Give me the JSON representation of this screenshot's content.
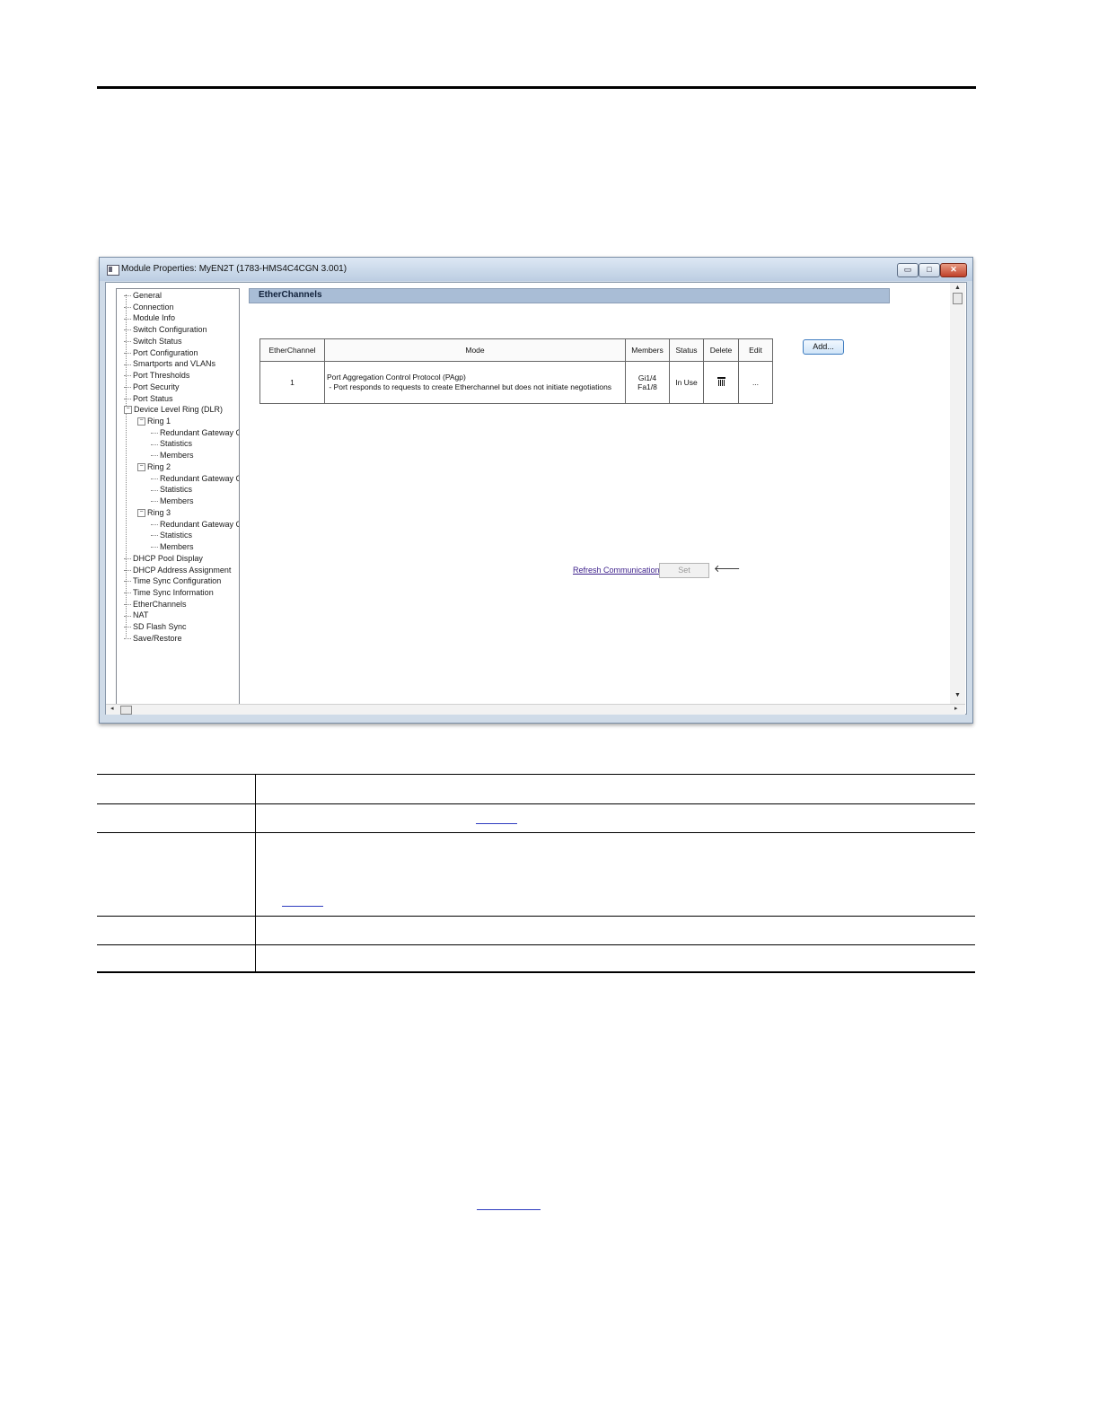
{
  "window": {
    "title": "Module Properties: MyEN2T (1783-HMS4C4CGN 3.001)",
    "buttons": {
      "minimize": "▭",
      "maximize": "□",
      "close": "✕"
    }
  },
  "tree": {
    "items": [
      {
        "label": "General",
        "level": 0
      },
      {
        "label": "Connection",
        "level": 0
      },
      {
        "label": "Module Info",
        "level": 0
      },
      {
        "label": "Switch Configuration",
        "level": 0
      },
      {
        "label": "Switch Status",
        "level": 0
      },
      {
        "label": "Port Configuration",
        "level": 0
      },
      {
        "label": "Smartports and VLANs",
        "level": 0
      },
      {
        "label": "Port Thresholds",
        "level": 0
      },
      {
        "label": "Port Security",
        "level": 0
      },
      {
        "label": "Port Status",
        "level": 0
      },
      {
        "label": "Device Level Ring (DLR)",
        "level": 0,
        "expander": "−"
      },
      {
        "label": "Ring 1",
        "level": 1,
        "expander": "−"
      },
      {
        "label": "Redundant Gateway Co",
        "level": 2
      },
      {
        "label": "Statistics",
        "level": 2
      },
      {
        "label": "Members",
        "level": 2
      },
      {
        "label": "Ring 2",
        "level": 1,
        "expander": "−"
      },
      {
        "label": "Redundant Gateway Co",
        "level": 2
      },
      {
        "label": "Statistics",
        "level": 2
      },
      {
        "label": "Members",
        "level": 2
      },
      {
        "label": "Ring 3",
        "level": 1,
        "expander": "−"
      },
      {
        "label": "Redundant Gateway Co",
        "level": 2
      },
      {
        "label": "Statistics",
        "level": 2
      },
      {
        "label": "Members",
        "level": 2
      },
      {
        "label": "DHCP Pool Display",
        "level": 0
      },
      {
        "label": "DHCP Address Assignment",
        "level": 0
      },
      {
        "label": "Time Sync Configuration",
        "level": 0
      },
      {
        "label": "Time Sync Information",
        "level": 0
      },
      {
        "label": "EtherChannels",
        "level": 0
      },
      {
        "label": "NAT",
        "level": 0
      },
      {
        "label": "SD Flash Sync",
        "level": 0
      },
      {
        "label": "Save/Restore",
        "level": 0
      }
    ]
  },
  "pane": {
    "header": "EtherChannels",
    "table": {
      "headers": [
        "EtherChannel",
        "Mode",
        "Members",
        "Status",
        "Delete",
        "Edit"
      ],
      "row": {
        "etherchannel": "1",
        "mode_line1": "Port Aggregation Control Protocol (PAgp)",
        "mode_line2": " - Port responds to requests to create Etherchannel but does not initiate negotiations",
        "members_line1": "Gi1/4",
        "members_line2": "Fa1/8",
        "status": "In Use",
        "edit": "..."
      }
    },
    "add_button": "Add...",
    "refresh_link": "Refresh Communication",
    "set_button": "Set",
    "arrow": "🡐"
  },
  "scroll": {
    "up": "▲",
    "down": "▼",
    "left": "◂",
    "right": "▸"
  }
}
